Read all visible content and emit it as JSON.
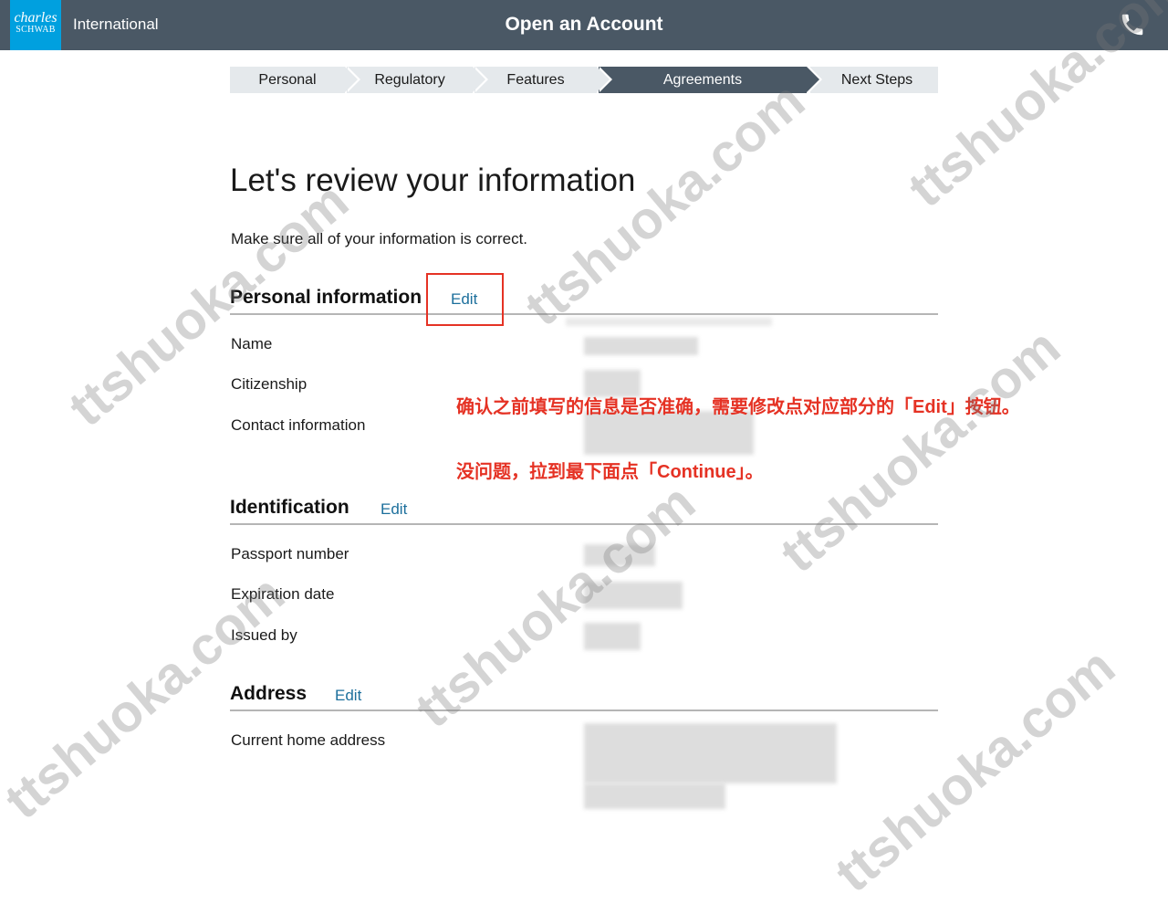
{
  "header": {
    "logo_line1": "charles",
    "logo_line2": "SCHWAB",
    "region": "International",
    "title": "Open an Account",
    "phone_icon": "phone-icon"
  },
  "stepper": {
    "steps": [
      {
        "label": "Personal",
        "active": false
      },
      {
        "label": "Regulatory",
        "active": false
      },
      {
        "label": "Features",
        "active": false
      },
      {
        "label": "Agreements",
        "active": true
      },
      {
        "label": "Next Steps",
        "active": false
      }
    ]
  },
  "main": {
    "title": "Let's review your information",
    "intro": "Make sure all of your information is correct.",
    "edit_label": "Edit",
    "sections": {
      "personal": {
        "title": "Personal information",
        "fields": [
          "Name",
          "Citizenship",
          "Contact information"
        ]
      },
      "identification": {
        "title": "Identification",
        "fields": [
          "Passport number",
          "Expiration date",
          "Issued by"
        ]
      },
      "address": {
        "title": "Address",
        "fields": [
          "Current home address"
        ]
      }
    }
  },
  "annotation": {
    "line1": "确认之前填写的信息是否准确，需要修改点对应部分的「Edit」按钮。",
    "line2": "没问题，拉到最下面点「Continue」。",
    "color": "#e53224"
  },
  "watermark": "ttshuoka.com",
  "colors": {
    "topbar": "#4a5865",
    "logo": "#00a0df",
    "link": "#1c6f9c",
    "step_inactive": "#e5e9ec"
  }
}
